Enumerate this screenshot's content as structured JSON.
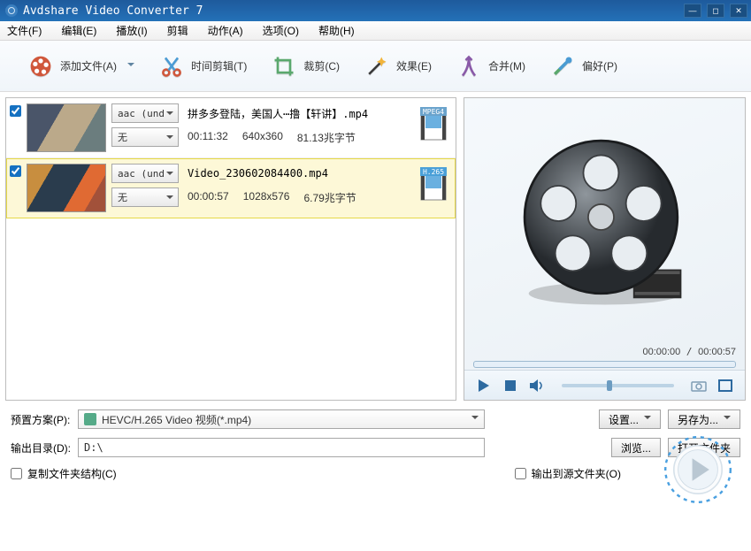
{
  "window": {
    "title": "Avdshare Video Converter 7"
  },
  "menubar": [
    "文件(F)",
    "编辑(E)",
    "播放(I)",
    "剪辑",
    "动作(A)",
    "选项(O)",
    "帮助(H)"
  ],
  "toolbar": {
    "add": "添加文件(A)",
    "trim": "时间剪辑(T)",
    "crop": "裁剪(C)",
    "effect": "效果(E)",
    "merge": "合并(M)",
    "pref": "偏好(P)"
  },
  "files": [
    {
      "checked": true,
      "title": "拼多多登陆，美国人⋯撸【轩讲】.mp4",
      "codec": "aac (und",
      "audio": "无",
      "duration": "00:11:32",
      "resolution": "640x360",
      "size": "81.13兆字节",
      "badge": "MPEG4",
      "badge_bg": "#6aa3cc",
      "selected": false
    },
    {
      "checked": true,
      "title": "Video_230602084400.mp4",
      "codec": "aac (und",
      "audio": "无",
      "duration": "00:00:57",
      "resolution": "1028x576",
      "size": "6.79兆字节",
      "badge": "H.265",
      "badge_bg": "#4aa0d8",
      "selected": true
    }
  ],
  "preview": {
    "current": "00:00:00",
    "total": "00:00:57"
  },
  "preset": {
    "label": "预置方案(P):",
    "value": "HEVC/H.265 Video 视频(*.mp4)",
    "settings": "设置...",
    "saveas": "另存为..."
  },
  "output": {
    "label": "输出目录(D):",
    "path": "D:\\",
    "browse": "浏览...",
    "open": "打开文件夹"
  },
  "opts": {
    "copy_structure": "复制文件夹结构(C)",
    "output_source": "输出到源文件夹(O)"
  }
}
